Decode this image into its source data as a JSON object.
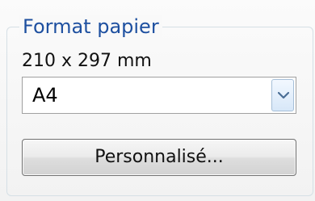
{
  "paper_format": {
    "group_title": "Format papier",
    "size_text": "210 x 297 mm",
    "selected_format": "A4",
    "custom_button_label": "Personnalisé..."
  },
  "icons": {
    "dropdown": "chevron-down-icon"
  },
  "colors": {
    "group_title_blue": "#1e50a0",
    "dropdown_chevron": "#4a6e95"
  }
}
